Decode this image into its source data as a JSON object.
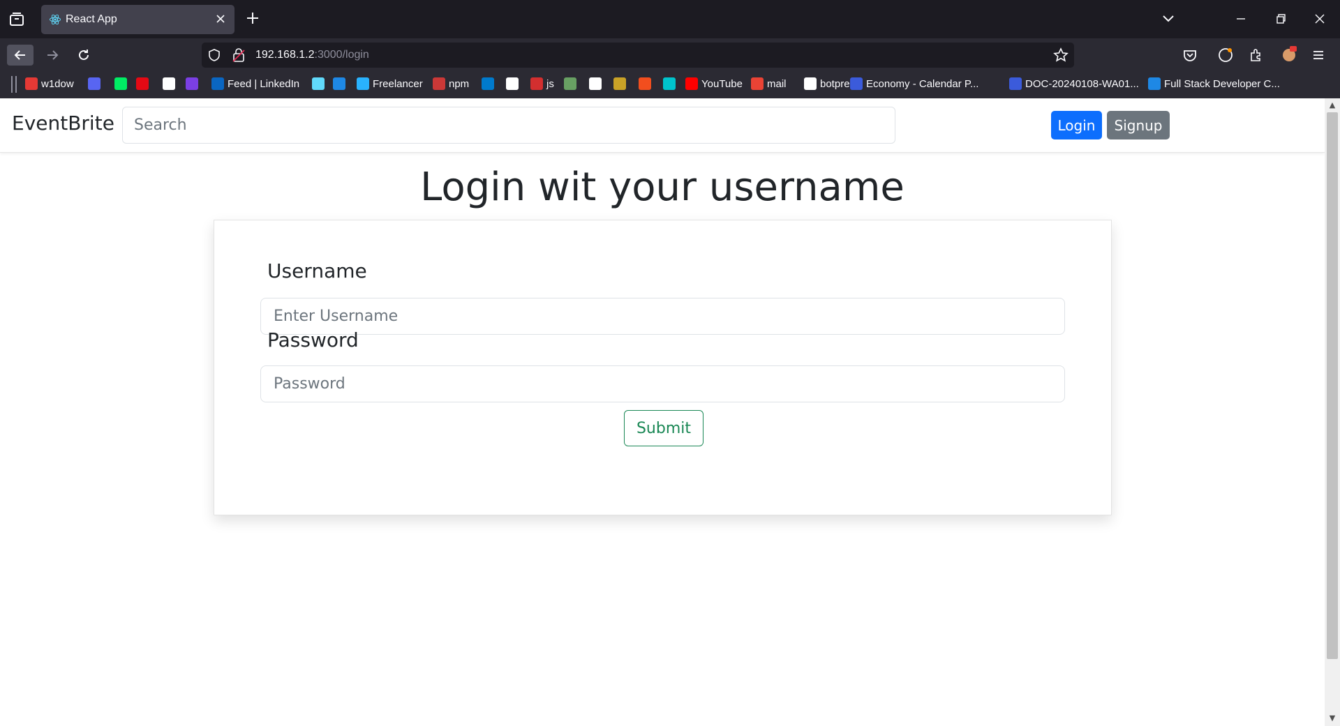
{
  "browser": {
    "tab_title": "React App",
    "url_host": "192.168.1.2",
    "url_path": ":3000/login",
    "bookmarks": [
      {
        "label": "w1dow",
        "icon": "w1dow-icon",
        "color": "#e53935"
      },
      {
        "label": "",
        "icon": "discord-icon",
        "color": "#5865f2"
      },
      {
        "label": "",
        "icon": "mongodb-icon",
        "color": "#00ed64"
      },
      {
        "label": "",
        "icon": "netflix-icon",
        "color": "#e50914"
      },
      {
        "label": "",
        "icon": "pulse-icon",
        "color": "#ffffff"
      },
      {
        "label": "",
        "icon": "app-icon",
        "color": "#7b3fe4"
      },
      {
        "label": "Feed | LinkedIn",
        "icon": "linkedin-icon",
        "color": "#0a66c2"
      },
      {
        "label": "",
        "icon": "react-icon",
        "color": "#61dafb"
      },
      {
        "label": "",
        "icon": "cloud-icon",
        "color": "#1e88e5"
      },
      {
        "label": "Freelancer",
        "icon": "freelancer-icon",
        "color": "#29b2fe"
      },
      {
        "label": "npm",
        "icon": "npm-icon",
        "color": "#cb3837"
      },
      {
        "label": "",
        "icon": "vscode-icon",
        "color": "#007acc"
      },
      {
        "label": "",
        "icon": "github-icon",
        "color": "#ffffff"
      },
      {
        "label": "js",
        "icon": "js-icon",
        "color": "#d32f2f"
      },
      {
        "label": "",
        "icon": "nodejs-icon",
        "color": "#68a063"
      },
      {
        "label": "",
        "icon": "wordpress-icon",
        "color": "#ffffff"
      },
      {
        "label": "",
        "icon": "hat-icon",
        "color": "#c9a227"
      },
      {
        "label": "",
        "icon": "figma-icon",
        "color": "#f24e1e"
      },
      {
        "label": "",
        "icon": "canva-icon",
        "color": "#00c4cc"
      },
      {
        "label": "YouTube",
        "icon": "youtube-icon",
        "color": "#ff0000"
      },
      {
        "label": "mail",
        "icon": "gmail-icon",
        "color": "#ea4335"
      },
      {
        "label": "botpress",
        "icon": "share-icon",
        "color": "#ffffff"
      },
      {
        "label": "Economy - Calendar P...",
        "icon": "canva-icon",
        "color": "#3b5bdb"
      },
      {
        "label": "DOC-20240108-WA01...",
        "icon": "canva-icon",
        "color": "#3b5bdb"
      },
      {
        "label": "Full Stack Developer C...",
        "icon": "ist-icon",
        "color": "#1e88e5"
      }
    ]
  },
  "app": {
    "brand": "EventBrite",
    "search_placeholder": "Search",
    "login_label": "Login",
    "signup_label": "Signup",
    "heading": "Login wit your username",
    "form": {
      "username_label": "Username",
      "username_placeholder": "Enter Username",
      "password_label": "Password",
      "password_placeholder": "Password",
      "submit_label": "Submit"
    }
  },
  "colors": {
    "primary": "#0d6efd",
    "secondary": "#6c757d",
    "success": "#198754"
  }
}
